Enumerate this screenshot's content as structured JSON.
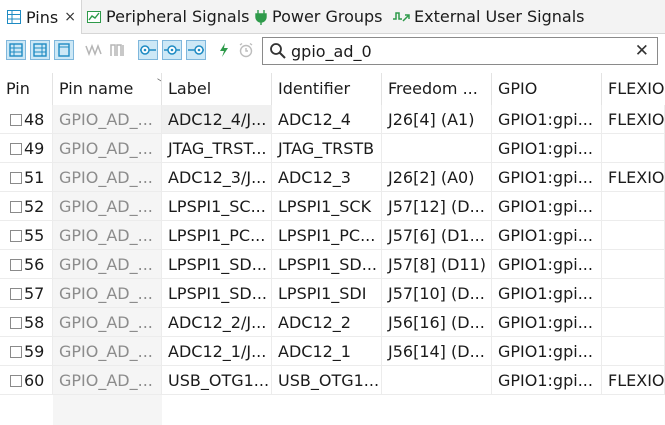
{
  "tabs": [
    {
      "label": "Pins",
      "icon": "table-icon",
      "active": true,
      "close": "×"
    },
    {
      "label": "Peripheral Signals",
      "icon": "signal-chart-icon"
    },
    {
      "label": "Power Groups",
      "icon": "power-plug-icon"
    },
    {
      "label": "External User Signals",
      "icon": "external-signal-icon"
    }
  ],
  "toolbar": {
    "buttons": [
      "columns-view-icon",
      "rows-view-icon",
      "single-view-icon",
      "wave-icon",
      "wave-tall-icon",
      "route-left-icon",
      "route-middle-icon",
      "route-right-icon",
      "lightning-icon",
      "alarm-icon"
    ]
  },
  "search": {
    "value": "gpio_ad_0",
    "clear": "✕"
  },
  "table": {
    "columns": [
      "Pin",
      "Pin name",
      "Label",
      "Identifier",
      "Freedom ...",
      "GPIO",
      "FLEXIO"
    ],
    "rows": [
      [
        "48",
        "GPIO_AD_...",
        "ADC12_4/J...",
        "ADC12_4",
        "J26[4] (A1)",
        "GPIO1:gpi...",
        "FLEXIO"
      ],
      [
        "49",
        "GPIO_AD_...",
        "JTAG_TRST...",
        "JTAG_TRSTB",
        "",
        "GPIO1:gpi...",
        ""
      ],
      [
        "51",
        "GPIO_AD_...",
        "ADC12_3/J...",
        "ADC12_3",
        "J26[2] (A0)",
        "GPIO1:gpi...",
        "FLEXIO"
      ],
      [
        "52",
        "GPIO_AD_...",
        "LPSPI1_SC...",
        "LPSPI1_SCK",
        "J57[12] (D...",
        "GPIO1:gpi...",
        ""
      ],
      [
        "55",
        "GPIO_AD_...",
        "LPSPI1_PC...",
        "LPSPI1_PC...",
        "J57[6] (D1...",
        "GPIO1:gpi...",
        ""
      ],
      [
        "56",
        "GPIO_AD_...",
        "LPSPI1_SD...",
        "LPSPI1_SD...",
        "J57[8] (D11)",
        "GPIO1:gpi...",
        ""
      ],
      [
        "57",
        "GPIO_AD_...",
        "LPSPI1_SD...",
        "LPSPI1_SDI",
        "J57[10] (D...",
        "GPIO1:gpi...",
        ""
      ],
      [
        "58",
        "GPIO_AD_...",
        "ADC12_2/J...",
        "ADC12_2",
        "J56[16] (D...",
        "GPIO1:gpi...",
        ""
      ],
      [
        "59",
        "GPIO_AD_...",
        "ADC12_1/J...",
        "ADC12_1",
        "J56[14] (D...",
        "GPIO1:gpi...",
        ""
      ],
      [
        "60",
        "GPIO_AD_...",
        "USB_OTG1...",
        "USB_OTG1...",
        "",
        "GPIO1:gpi...",
        "FLEXIO"
      ]
    ]
  },
  "colors": {
    "accent": "#1e8bc3",
    "green": "#2e9a4a",
    "toolbar_selected_bg": "#cde8f6"
  }
}
